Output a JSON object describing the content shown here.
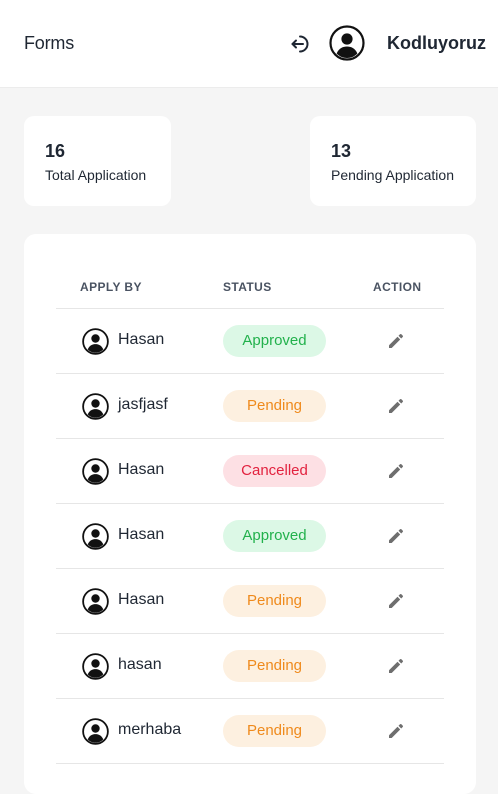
{
  "header": {
    "title": "Forms",
    "username": "Kodluyoruz",
    "logout_icon": "logout-icon",
    "avatar_icon": "user-circle-icon"
  },
  "stats": {
    "total": {
      "value": "16",
      "label": "Total Application"
    },
    "pending": {
      "value": "13",
      "label": "Pending Application"
    }
  },
  "table": {
    "headers": {
      "apply_by": "APPLY BY",
      "status": "STATUS",
      "action": "ACTION"
    },
    "rows": [
      {
        "name": "Hasan",
        "status": "Approved",
        "status_type": "approved"
      },
      {
        "name": "jasfjasf",
        "status": "Pending",
        "status_type": "pending"
      },
      {
        "name": "Hasan",
        "status": "Cancelled",
        "status_type": "cancelled"
      },
      {
        "name": "Hasan",
        "status": "Approved",
        "status_type": "approved"
      },
      {
        "name": "Hasan",
        "status": "Pending",
        "status_type": "pending"
      },
      {
        "name": "hasan",
        "status": "Pending",
        "status_type": "pending"
      },
      {
        "name": "merhaba",
        "status": "Pending",
        "status_type": "pending"
      }
    ]
  },
  "colors": {
    "approved_bg": "#dcf8e6",
    "approved_text": "#22b14c",
    "pending_bg": "#fdf0e0",
    "pending_text": "#ef8a1c",
    "cancelled_bg": "#fde0e4",
    "cancelled_text": "#e2223f"
  }
}
